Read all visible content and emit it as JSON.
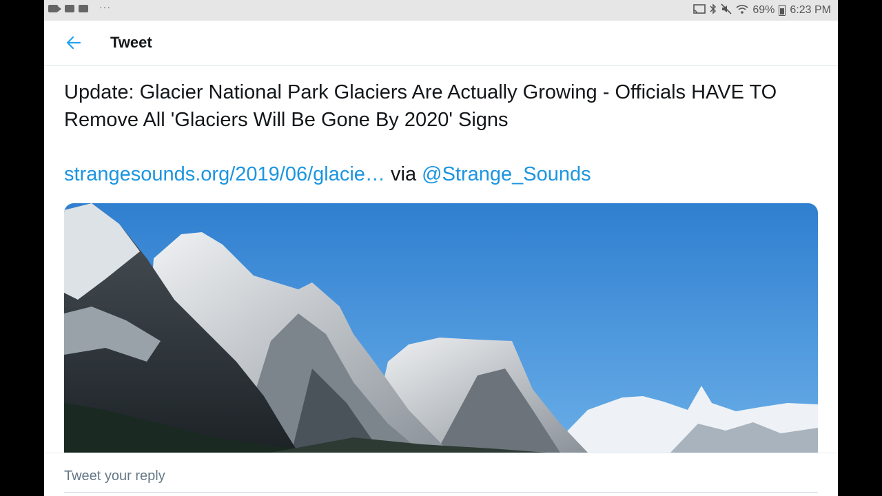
{
  "status_bar": {
    "left_icons": [
      "camera-icon",
      "youtube-icon",
      "youtube-icon"
    ],
    "overflow": "···",
    "battery": "69%",
    "time": "6:23 PM"
  },
  "header": {
    "back_icon": "arrow-left-icon",
    "title": "Tweet"
  },
  "tweet": {
    "text": "Update: Glacier National Park Glaciers Are Actually Growing - Officials HAVE TO Remove All 'Glaciers Will Be Gone By 2020' Signs",
    "link": "strangesounds.org/2019/06/glacie…",
    "via": " via ",
    "mention": "@Strange_Sounds",
    "media": "mountain-photo"
  },
  "reply": {
    "placeholder": "Tweet your reply"
  },
  "colors": {
    "link": "#1b95e0",
    "text": "#14171a",
    "status_bar_bg": "#e6e6e6"
  }
}
